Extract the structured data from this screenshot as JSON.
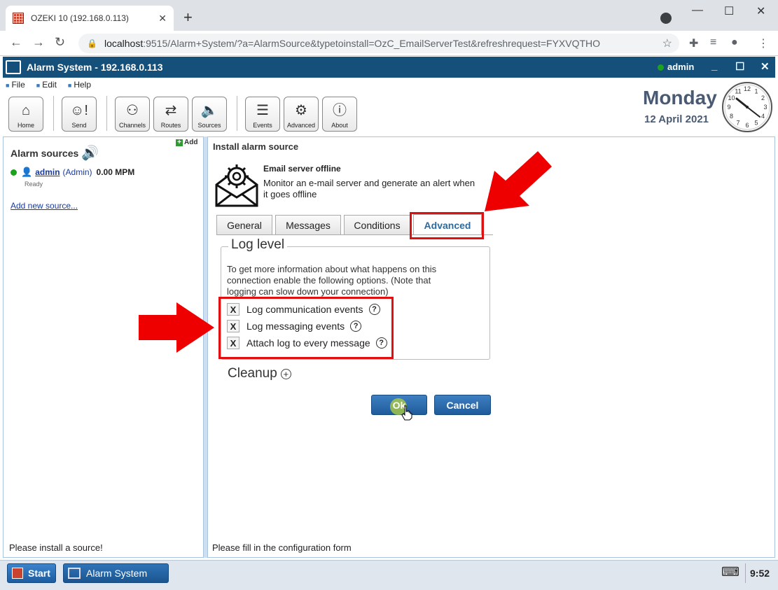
{
  "browser": {
    "tab_title": "OZEKI 10 (192.168.0.113)",
    "url_host": "localhost",
    "url_path": ":9515/Alarm+System/?a=AlarmSource&typetoinstall=OzC_EmailServerTest&refreshrequest=FYXVQTHO"
  },
  "app": {
    "title": "Alarm System - 192.168.0.113",
    "user": "admin"
  },
  "menu": [
    "File",
    "Edit",
    "Help"
  ],
  "toolbar": [
    {
      "label": "Home",
      "icon": "home-icon"
    },
    {
      "label": "Send",
      "icon": "send-icon"
    },
    {
      "label": "Channels",
      "icon": "channels-icon"
    },
    {
      "label": "Routes",
      "icon": "routes-icon"
    },
    {
      "label": "Sources",
      "icon": "sources-icon"
    },
    {
      "label": "Events",
      "icon": "events-icon"
    },
    {
      "label": "Advanced",
      "icon": "gear-icon"
    },
    {
      "label": "About",
      "icon": "info-icon"
    }
  ],
  "datetime": {
    "day": "Monday",
    "date": "12 April 2021",
    "clock_numbers": [
      "12",
      "1",
      "2",
      "3",
      "4",
      "5",
      "6",
      "7",
      "8",
      "9",
      "10",
      "11"
    ]
  },
  "left_panel": {
    "title": "Alarm sources",
    "add_label": "Add",
    "source": {
      "name": "admin",
      "type": "(Admin)",
      "rate": "0.00 MPM",
      "status": "Ready"
    },
    "add_new_link": "Add new source...",
    "status_text": "Please install a source!"
  },
  "right_panel": {
    "title": "Install alarm source",
    "source_name": "Email server offline",
    "source_desc": "Monitor an e-mail server and generate an alert when it goes offline",
    "tabs": [
      "General",
      "Messages",
      "Conditions",
      "Advanced"
    ],
    "active_tab": "Advanced",
    "log_level": {
      "legend": "Log level",
      "description": "To get more information about what happens on this connection enable the following options. (Note that logging can slow down your connection)",
      "options": [
        {
          "label": "Log communication events",
          "checked_mark": "X"
        },
        {
          "label": "Log messaging events",
          "checked_mark": "X"
        },
        {
          "label": "Attach log to every message",
          "checked_mark": "X"
        }
      ],
      "help_glyph": "?"
    },
    "cleanup_label": "Cleanup",
    "ok_label": "Ok",
    "cancel_label": "Cancel",
    "status_text": "Please fill in the configuration form"
  },
  "taskbar": {
    "start_label": "Start",
    "task_label": "Alarm System",
    "time": "9:52"
  },
  "colors": {
    "header_blue": "#15507b",
    "accent_red": "#e01010",
    "button_blue": "#1f5b9c"
  }
}
